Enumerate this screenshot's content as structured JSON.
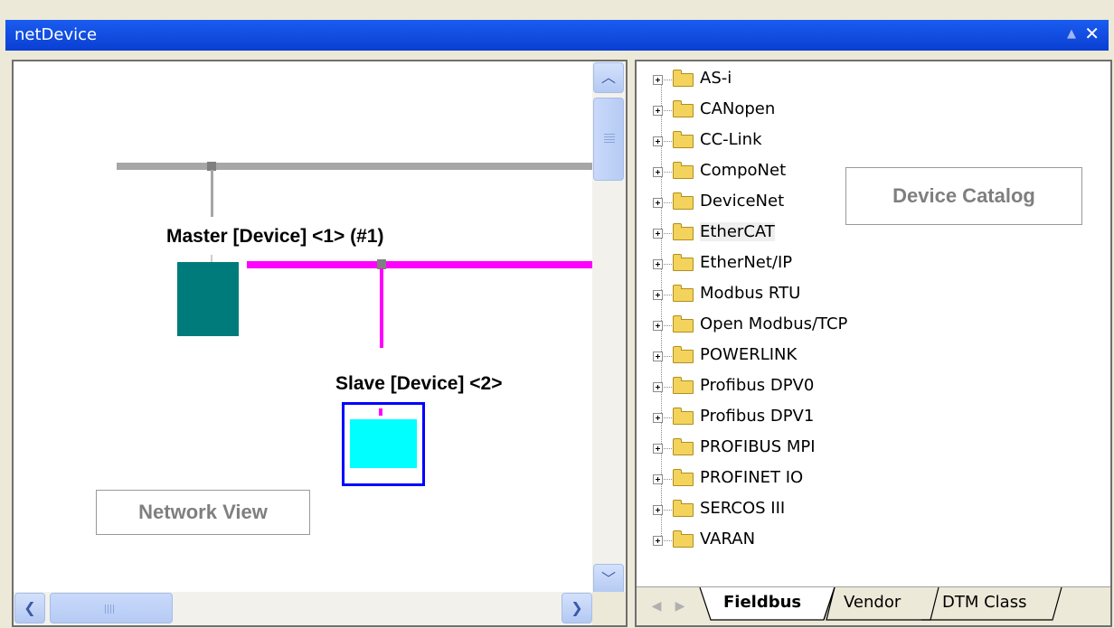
{
  "window": {
    "title": "netDevice",
    "pin_icon": "▲",
    "close_icon": "✕"
  },
  "network_view": {
    "callout": "Network View",
    "master_label": "Master [Device] <1> (#1)",
    "slave_label": "Slave [Device] <2>",
    "colors": {
      "upper_bus": "#a6a6a6",
      "fieldbus": "#ff00ff",
      "master": "#007b7b",
      "slave": "#00ffff",
      "selection": "#0000ff"
    }
  },
  "device_catalog": {
    "callout": "Device Catalog",
    "items": [
      {
        "label": "AS-i"
      },
      {
        "label": "CANopen"
      },
      {
        "label": "CC-Link"
      },
      {
        "label": "CompoNet"
      },
      {
        "label": "DeviceNet"
      },
      {
        "label": "EtherCAT"
      },
      {
        "label": "EtherNet/IP"
      },
      {
        "label": "Modbus RTU"
      },
      {
        "label": "Open Modbus/TCP"
      },
      {
        "label": "POWERLINK"
      },
      {
        "label": "Profibus DPV0"
      },
      {
        "label": "Profibus DPV1"
      },
      {
        "label": "PROFIBUS MPI"
      },
      {
        "label": "PROFINET IO"
      },
      {
        "label": "SERCOS III"
      },
      {
        "label": "VARAN"
      }
    ],
    "highlighted_item": "EtherCAT",
    "tabs": [
      {
        "label": "Fieldbus",
        "active": true
      },
      {
        "label": "Vendor",
        "active": false
      },
      {
        "label": "DTM Class",
        "active": false
      }
    ]
  }
}
